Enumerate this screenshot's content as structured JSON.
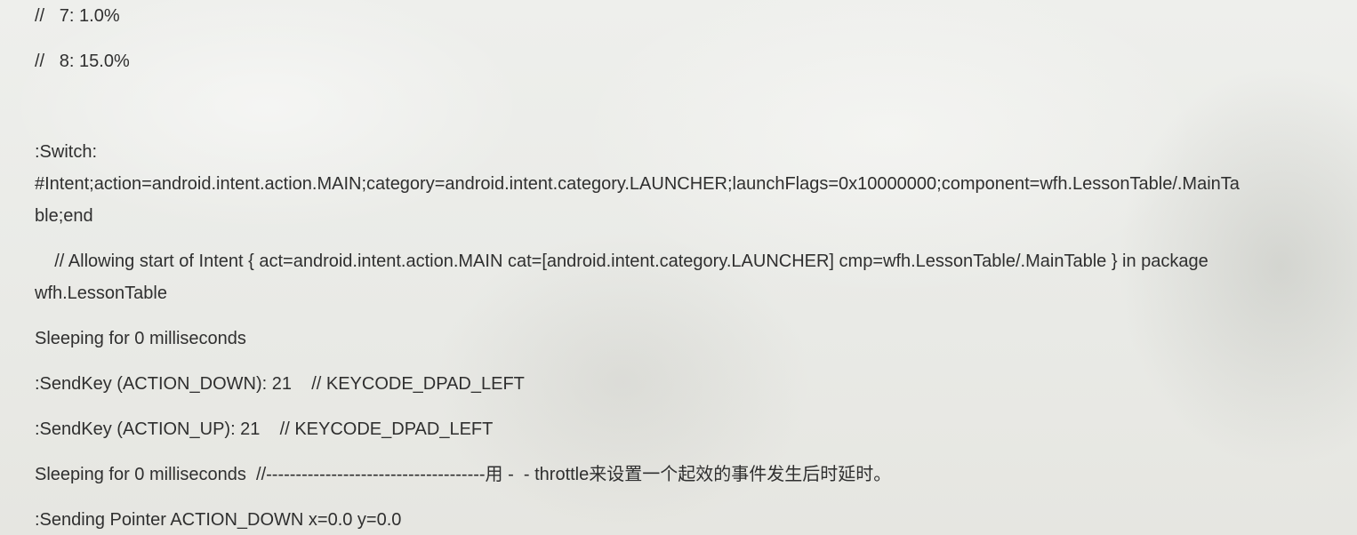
{
  "lines": [
    "//   7: 1.0%",
    "//   8: 15.0%",
    ":Switch:",
    "#Intent;action=android.intent.action.MAIN;category=android.intent.category.LAUNCHER;launchFlags=0x10000000;component=wfh.LessonTable/.MainTa",
    "ble;end",
    "    // Allowing start of Intent { act=android.intent.action.MAIN cat=[android.intent.category.LAUNCHER] cmp=wfh.LessonTable/.MainTable } in package",
    "wfh.LessonTable",
    "Sleeping for 0 milliseconds",
    ":SendKey (ACTION_DOWN): 21    // KEYCODE_DPAD_LEFT",
    ":SendKey (ACTION_UP): 21    // KEYCODE_DPAD_LEFT",
    "Sleeping for 0 milliseconds  //-------------------------------------用 -  - throttle来设置一个起效的事件发生后时延时。",
    ":Sending Pointer ACTION_DOWN x=0.0 y=0.0"
  ]
}
